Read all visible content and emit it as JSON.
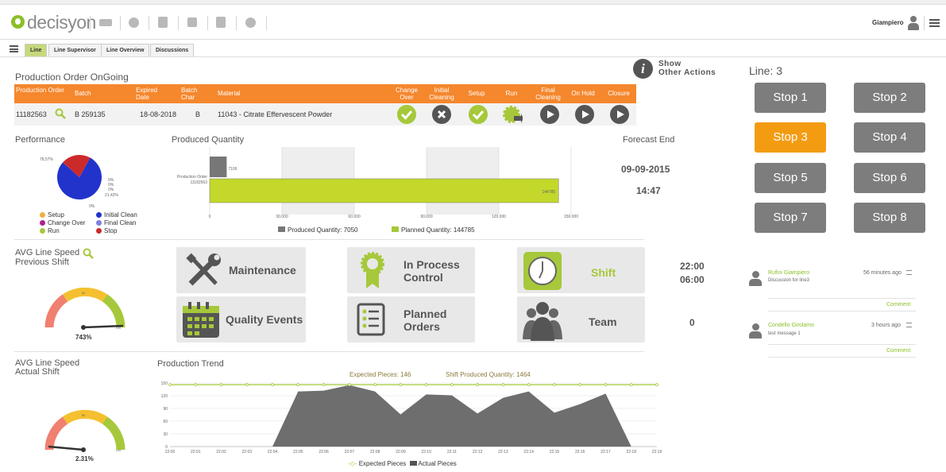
{
  "app": {
    "logo_text": "decisyon",
    "user": "Giampiero"
  },
  "toolbar_icons": [
    "mail-icon",
    "clock-icon",
    "clipboard-icon",
    "save-icon",
    "document-icon",
    "add-icon"
  ],
  "tabs": [
    "Line",
    "Line Supervisor",
    "Line Overview",
    "Discussions"
  ],
  "production": {
    "title": "Production Order OnGoing",
    "headers": {
      "order": "Production Order",
      "batch": "Batch",
      "expired": "Expired Date",
      "batch_char": "Batch Char",
      "material": "Material",
      "change_over": "Change Over",
      "initial_cleaning": "Initial Cleaning",
      "setup": "Setup",
      "run": "Run",
      "final_cleaning": "Final Cleaning",
      "on_hold": "On Hold",
      "closure": "Closure"
    },
    "row": {
      "order": "11182563",
      "batch": "B 259135",
      "expired": "18-08-2018",
      "batch_char": "B",
      "material": "11043 - Citrate Effervescent Powder"
    },
    "step_states": {
      "change_over": "done",
      "initial_cleaning": "cancelled",
      "setup": "done",
      "run": "running",
      "final_cleaning": "pending",
      "on_hold": "pending",
      "closure": "pending"
    }
  },
  "actions": {
    "label_line1": "Show",
    "label_line2": "Other Actions"
  },
  "line": {
    "title": "Line: 3",
    "stops": [
      "Stop 1",
      "Stop 2",
      "Stop 3",
      "Stop 4",
      "Stop 5",
      "Stop 6",
      "Stop 7",
      "Stop 8"
    ],
    "active_stop": "Stop 3"
  },
  "performance": {
    "title": "Performance",
    "label_run": "78,57%",
    "label_stop": "21,42%",
    "label_zero": "0%",
    "legend": [
      {
        "name": "Setup",
        "color": "#f0b040"
      },
      {
        "name": "Initial Clean",
        "color": "#2233cc"
      },
      {
        "name": "Change Over",
        "color": "#b02090"
      },
      {
        "name": "Final Clean",
        "color": "#7f7fe0"
      },
      {
        "name": "Run",
        "color": "#a6c83a"
      },
      {
        "name": "Stop",
        "color": "#cc2a2a"
      }
    ]
  },
  "produced": {
    "title": "Produced Quantity",
    "row_label_1": "Production Order",
    "row_label_2": "11182563",
    "produced_label": "7106",
    "planned_label": "144785",
    "ticks": [
      "0",
      "30.000",
      "60.000",
      "90.000",
      "120.000",
      "150.000"
    ],
    "legend_produced": "Produced Quantity: 7050",
    "legend_planned": "Planned Quantity: 144785"
  },
  "forecast": {
    "title": "Forecast End",
    "date": "09-09-2015",
    "time": "14:47"
  },
  "speed_prev": {
    "title_line1": "AVG Line Speed",
    "title_line2": "Previous Shift",
    "value": "743%",
    "gauge_mid": "50",
    "gauge_max": "100"
  },
  "speed_actual": {
    "title_line1": "AVG Line Speed",
    "title_line2": "Actual Shift",
    "value": "2.31%",
    "gauge_mid": "50",
    "gauge_max": "100"
  },
  "tiles": [
    {
      "id": "maintenance",
      "label_line1": "Maintenance",
      "label_line2": ""
    },
    {
      "id": "in-process-control",
      "label_line1": "In Process",
      "label_line2": "Control"
    },
    {
      "id": "shift",
      "label_line1": "Shift",
      "label_line2": ""
    },
    {
      "id": "quality-events",
      "label_line1": "Quality Events",
      "label_line2": ""
    },
    {
      "id": "planned-orders",
      "label_line1": "Planned",
      "label_line2": "Orders"
    },
    {
      "id": "team",
      "label_line1": "Team",
      "label_line2": ""
    }
  ],
  "shift_times": {
    "start": "22:00",
    "end": "06:00",
    "team_count": "0"
  },
  "comments": [
    {
      "name": "Rufini Giampiero",
      "text": "Discussion for line3",
      "time": "56 minutes ago",
      "action": "Comment"
    },
    {
      "name": "Condello Girolamo",
      "text": "test message 1",
      "time": "3 hours ago",
      "action": "Comment"
    }
  ],
  "trend": {
    "title": "Production Trend",
    "expected_label": "Expected Pieces: 146",
    "shift_label": "Shift Produced Quantity: 1464",
    "legend_expected": "Expected Pieces",
    "legend_actual": "Actual Pieces"
  },
  "chart_data": [
    {
      "type": "pie",
      "title": "Performance",
      "categories": [
        "Setup",
        "Initial Clean",
        "Change Over",
        "Final Clean",
        "Run",
        "Stop"
      ],
      "values": [
        0,
        78.57,
        0,
        0,
        0,
        21.42
      ]
    },
    {
      "type": "bar",
      "title": "Produced Quantity",
      "categories": [
        "Production Order 11182563"
      ],
      "series": [
        {
          "name": "Produced Quantity",
          "values": [
            7050
          ]
        },
        {
          "name": "Planned Quantity",
          "values": [
            144785
          ]
        }
      ],
      "xlim": [
        0,
        150000
      ]
    },
    {
      "type": "area",
      "title": "Production Trend",
      "x": [
        "22:00",
        "22:01",
        "22:02",
        "22:03",
        "22:04",
        "22:05",
        "22:06",
        "22:07",
        "22:08",
        "22:09",
        "22:10",
        "22:11",
        "22:12",
        "22:13",
        "22:14",
        "22:15",
        "22:16",
        "22:17",
        "22:18",
        "22:19"
      ],
      "series": [
        {
          "name": "Expected Pieces",
          "values": [
            146,
            146,
            146,
            146,
            146,
            146,
            146,
            146,
            146,
            146,
            146,
            146,
            146,
            146,
            146,
            146,
            146,
            146,
            146,
            146
          ]
        },
        {
          "name": "Actual Pieces",
          "values": [
            0,
            0,
            0,
            0,
            0,
            130,
            132,
            145,
            130,
            76,
            123,
            121,
            78,
            115,
            130,
            80,
            100,
            125,
            0,
            0
          ]
        }
      ],
      "yticks": [
        "0",
        "30",
        "60",
        "90",
        "120",
        "150"
      ],
      "ylim": [
        0,
        150
      ]
    }
  ]
}
